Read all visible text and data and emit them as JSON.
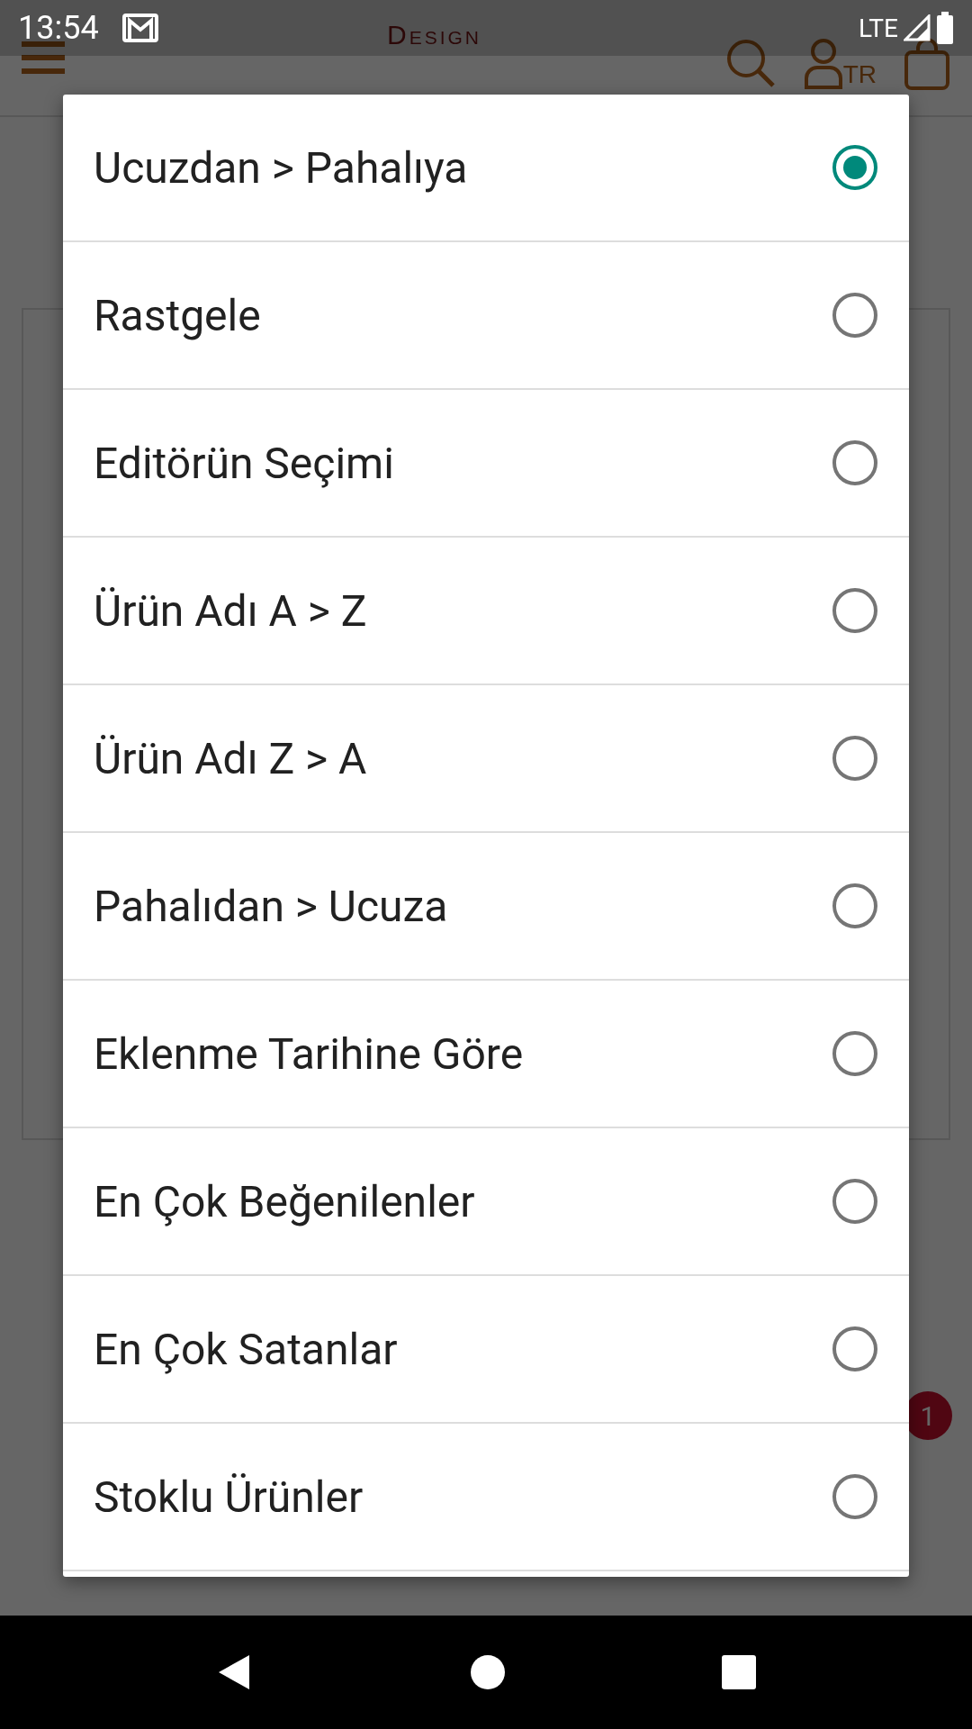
{
  "status_bar": {
    "time": "13:54",
    "network": "LTE"
  },
  "header": {
    "logo_sub": "Design",
    "language": "TR"
  },
  "cart_badge": "1",
  "sort_dialog": {
    "options": [
      {
        "label": "Ucuzdan > Pahalıya",
        "selected": true
      },
      {
        "label": "Rastgele",
        "selected": false
      },
      {
        "label": "Editörün Seçimi",
        "selected": false
      },
      {
        "label": "Ürün Adı A > Z",
        "selected": false
      },
      {
        "label": "Ürün Adı Z > A",
        "selected": false
      },
      {
        "label": "Pahalıdan > Ucuza",
        "selected": false
      },
      {
        "label": "Eklenme Tarihine Göre",
        "selected": false
      },
      {
        "label": "En Çok Beğenilenler",
        "selected": false
      },
      {
        "label": "En Çok Satanlar",
        "selected": false
      },
      {
        "label": "Stoklu Ürünler",
        "selected": false
      }
    ]
  }
}
